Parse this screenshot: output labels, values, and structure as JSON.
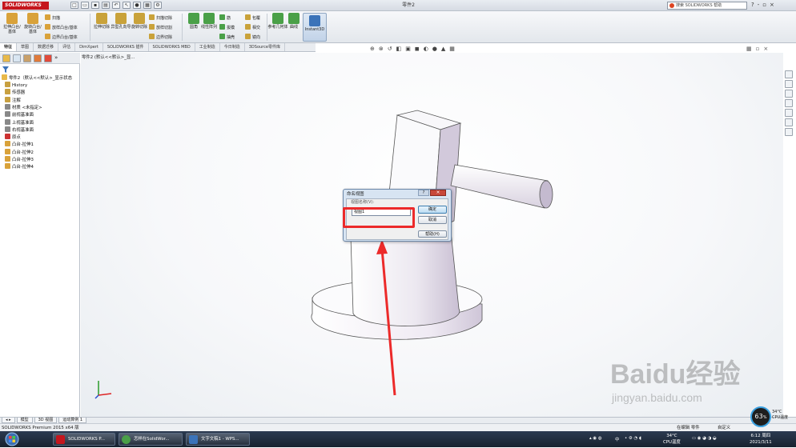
{
  "app": {
    "logo": "SOLIDWORKS",
    "window_title": "零件2",
    "search_placeholder": "搜索 SOLIDWORKS 帮助",
    "title_icons": [
      "?",
      "-",
      "▫",
      "×"
    ]
  },
  "ribbon": {
    "big_buttons": [
      {
        "label": "拉伸凸台/基体",
        "color": "#d9a23a"
      },
      {
        "label": "旋转凸台/基体",
        "color": "#d9a23a"
      },
      {
        "label": "拉伸切除",
        "color": "#c9a23a"
      },
      {
        "label": "异型孔向导",
        "color": "#c9a23a"
      },
      {
        "label": "旋转切除",
        "color": "#c9a23a"
      },
      {
        "label": "圆角",
        "color": "#4aa048"
      },
      {
        "label": "线性阵列",
        "color": "#4aa048"
      },
      {
        "label": "参考几何体",
        "color": "#4aa048"
      },
      {
        "label": "曲线",
        "color": "#4aa048"
      },
      {
        "label": "Instant3D",
        "color": "#3b73b9"
      }
    ],
    "small_buttons": [
      {
        "label": "扫描"
      },
      {
        "label": "放样凸台/基体"
      },
      {
        "label": "边界凸台/基体"
      },
      {
        "label": "扫描切除"
      },
      {
        "label": "放样切割"
      },
      {
        "label": "边界切除"
      },
      {
        "label": "筋"
      },
      {
        "label": "拔模"
      },
      {
        "label": "抽壳"
      },
      {
        "label": "包覆"
      },
      {
        "label": "相交"
      },
      {
        "label": "镜向"
      }
    ]
  },
  "tabs": [
    "特征",
    "草图",
    "数据迁移",
    "评估",
    "DimXpert",
    "SOLIDWORKS 插件",
    "SOLIDWORKS MBD",
    "工业制造",
    "今日制造",
    "3DSource零件库"
  ],
  "feature_tree": {
    "root": "零件2（默认<<默认>_显示状态",
    "items": [
      {
        "label": "History",
        "color": "#c8a040"
      },
      {
        "label": "传感器",
        "color": "#c8a040"
      },
      {
        "label": "注解",
        "color": "#c8a040"
      },
      {
        "label": "材质 <未指定>",
        "color": "#888888"
      },
      {
        "label": "前视基准面",
        "color": "#888888"
      },
      {
        "label": "上视基准面",
        "color": "#888888"
      },
      {
        "label": "右视基准面",
        "color": "#888888"
      },
      {
        "label": "原点",
        "color": "#cc3333"
      },
      {
        "label": "凸台-拉伸1",
        "color": "#d9a23a"
      },
      {
        "label": "凸台-拉伸2",
        "color": "#d9a23a"
      },
      {
        "label": "凸台-拉伸3",
        "color": "#d9a23a"
      },
      {
        "label": "凸台-拉伸4",
        "color": "#d9a23a"
      }
    ]
  },
  "viewport": {
    "breadcrumb": "零件2 (默认<<默认>_显..."
  },
  "dialog": {
    "title": "命名视图",
    "field_label": "视图名称(V):",
    "field_value": "视图1",
    "ok_label": "确定",
    "cancel_label": "取消",
    "help_label": "帮助(H)",
    "help_icon": "?",
    "close_icon": "×"
  },
  "bottom_tabs": [
    "模型",
    "3D 视图",
    "运动算例 1"
  ],
  "status": {
    "left": "SOLIDWORKS Premium 2015 x64 版",
    "editing": "在编辑 零件",
    "custom": "自定义"
  },
  "taskbar": {
    "buttons": [
      {
        "label": "SOLIDWORKS P...",
        "color": "#c5161d"
      },
      {
        "label": "怎样在SolidWor...",
        "color": "#4aa048"
      },
      {
        "label": "文字文稿1 - WPS...",
        "color": "#3b73b9"
      }
    ],
    "temp": "34°C",
    "temp_label": "CPU温度",
    "ime": "中",
    "time": "6:12 周四",
    "date": "2021/3/11"
  },
  "overlay": {
    "gauge_value": "63",
    "gauge_unit": "%",
    "gauge_temp": "34°C",
    "gauge_label": "CPU温度",
    "watermark_main": "Baidu经验",
    "watermark_sub": "jingyan.baidu.com"
  },
  "colors": {
    "accent_red": "#ec2a2a",
    "model_face": "#f4f3f6",
    "model_shade": "#c8bfd2",
    "model_dark": "#b4aabd"
  }
}
